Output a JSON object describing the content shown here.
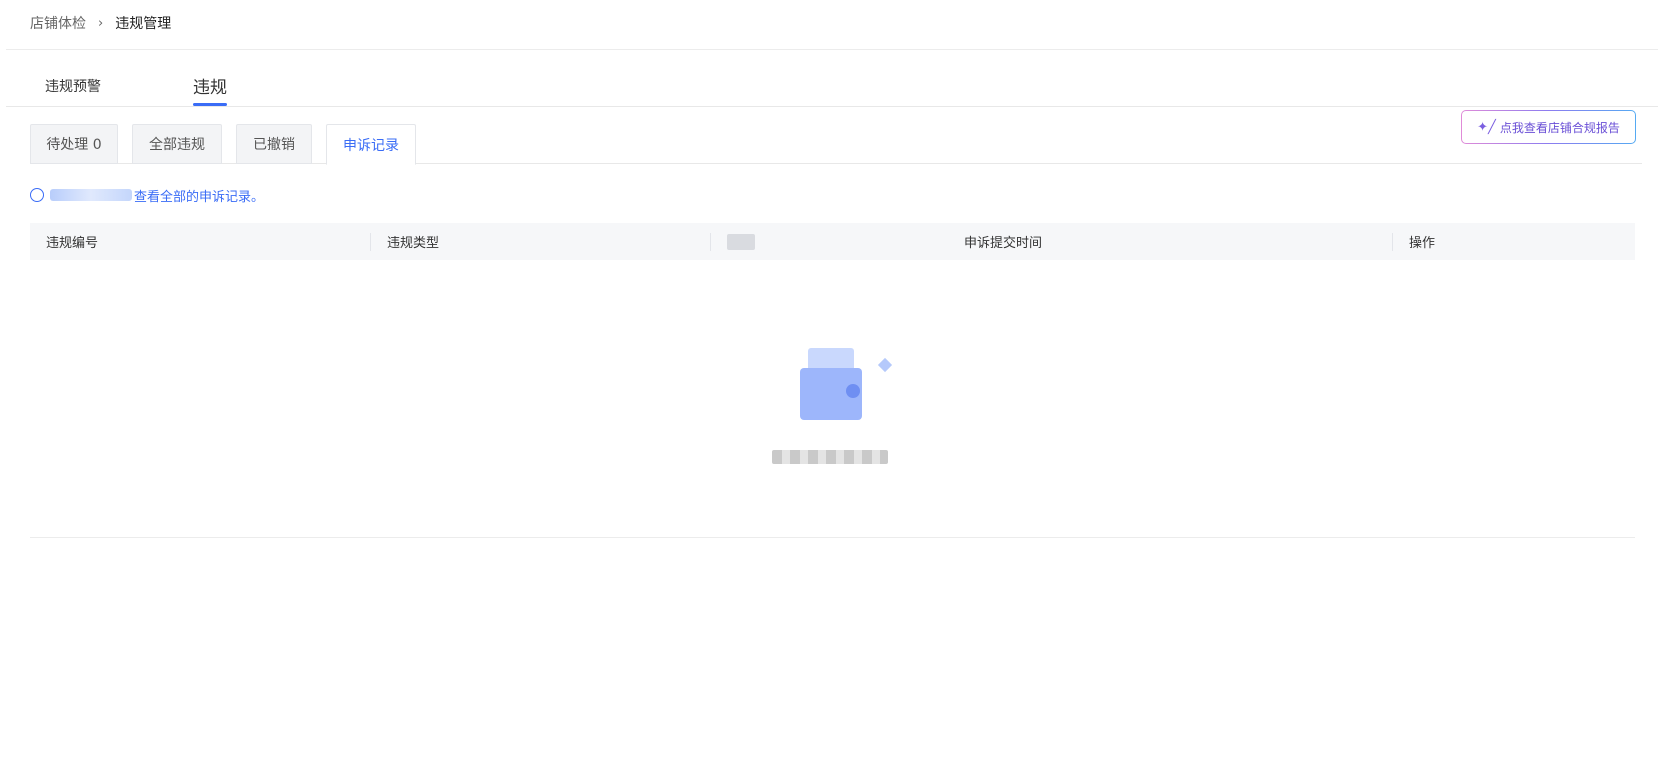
{
  "breadcrumb": {
    "parent": "店铺体检",
    "separator": "›",
    "current": "违规管理"
  },
  "main_tabs": [
    {
      "label": "违规预警"
    },
    {
      "label": "违规"
    }
  ],
  "sub_tabs": [
    {
      "label": "待处理 0"
    },
    {
      "label": "全部违规"
    },
    {
      "label": "已撤销"
    },
    {
      "label": "申诉记录"
    }
  ],
  "report_button": {
    "icon": "sparkle-icon",
    "label": "点我查看店铺合规报告"
  },
  "info": {
    "text": "查看全部的申诉记录。"
  },
  "table": {
    "columns": [
      "违规编号",
      "违规类型",
      "",
      "申诉提交时间",
      "操作"
    ]
  },
  "empty_state": {
    "icon": "empty-box-icon"
  },
  "colors": {
    "accent": "#3a6cf6",
    "report_text": "#6a4fd6"
  }
}
